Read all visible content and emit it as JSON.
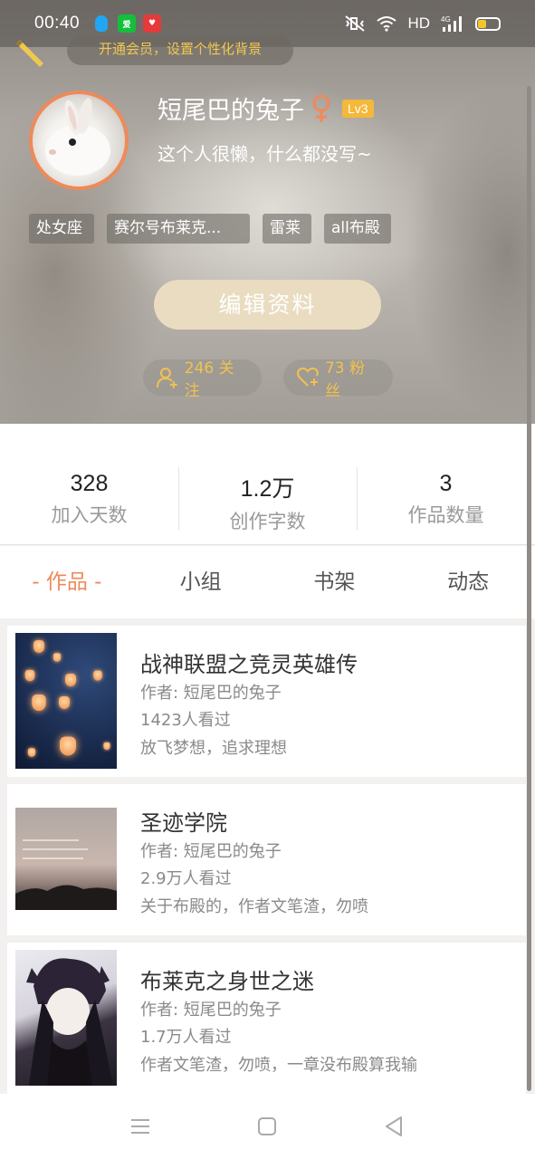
{
  "status_bar": {
    "time": "00:40",
    "apps": [
      "qq-icon",
      "iqiyi-icon",
      "heart-app-icon"
    ],
    "iqiyi_text": "爱",
    "heart_text": "♥",
    "network": "HD",
    "signal": "4G",
    "battery_level": 0.4
  },
  "header": {
    "vip_text": "开通会员，设置个性化背景",
    "nickname": "短尾巴的兔子",
    "level": "Lv3",
    "signature": "这个人很懒，什么都没写~",
    "tags": [
      "处女座",
      "赛尔号布莱克...",
      "雷莱",
      "all布殿"
    ],
    "edit_button": "编辑资料",
    "following": "246 关注",
    "followers": "73 粉丝",
    "colors": {
      "accent": "#ee8a5a",
      "gold": "#f1c24e",
      "level_badge": "#f4b83a"
    }
  },
  "stats": [
    {
      "value": "328",
      "label": "加入天数"
    },
    {
      "value": "1.2万",
      "label": "创作字数"
    },
    {
      "value": "3",
      "label": "作品数量"
    }
  ],
  "tabs": [
    "- 作品 -",
    "小组",
    "书架",
    "动态"
  ],
  "works": [
    {
      "title": "战神联盟之竞灵英雄传",
      "author": "作者: 短尾巴的兔子",
      "views": "1423人看过",
      "desc": "放飞梦想，追求理想"
    },
    {
      "title": "圣迹学院",
      "author": "作者: 短尾巴的兔子",
      "views": "2.9万人看过",
      "desc": "关于布殿的，作者文笔渣，勿喷"
    },
    {
      "title": "布莱克之身世之迷",
      "author": "作者: 短尾巴的兔子",
      "views": "1.7万人看过",
      "desc": "作者文笔渣，勿喷，一章没布殿算我输"
    }
  ],
  "nav": [
    "menu-icon",
    "home-icon",
    "back-icon"
  ]
}
